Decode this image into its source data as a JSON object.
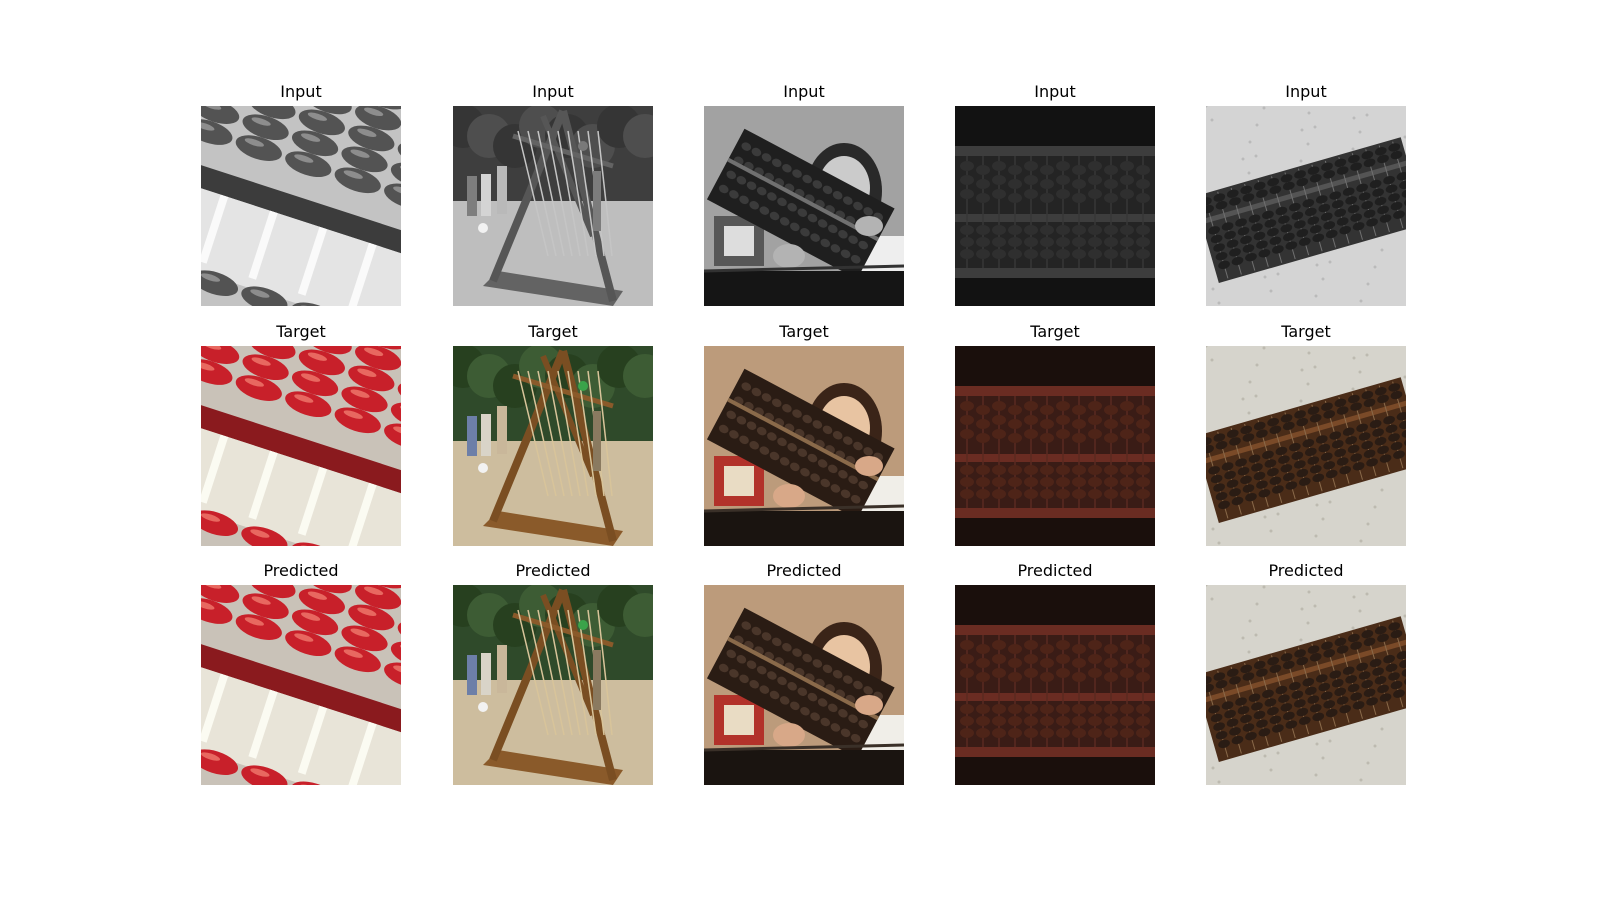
{
  "figure": {
    "rows": [
      {
        "row": "input",
        "items": [
          {
            "title": "Input",
            "image": "abacus-closeup-beads",
            "tone": "gray"
          },
          {
            "title": "Input",
            "image": "giant-wooden-abacus-park",
            "tone": "gray"
          },
          {
            "title": "Input",
            "image": "woman-holding-abacus",
            "tone": "gray"
          },
          {
            "title": "Input",
            "image": "abacus-dark-frame",
            "tone": "gray"
          },
          {
            "title": "Input",
            "image": "abacus-on-carpet",
            "tone": "gray"
          }
        ]
      },
      {
        "row": "target",
        "items": [
          {
            "title": "Target",
            "image": "abacus-closeup-beads",
            "tone": "color"
          },
          {
            "title": "Target",
            "image": "giant-wooden-abacus-park",
            "tone": "color"
          },
          {
            "title": "Target",
            "image": "woman-holding-abacus",
            "tone": "color"
          },
          {
            "title": "Target",
            "image": "abacus-dark-frame",
            "tone": "color"
          },
          {
            "title": "Target",
            "image": "abacus-on-carpet",
            "tone": "color"
          }
        ]
      },
      {
        "row": "predicted",
        "items": [
          {
            "title": "Predicted",
            "image": "abacus-closeup-beads",
            "tone": "color"
          },
          {
            "title": "Predicted",
            "image": "giant-wooden-abacus-park",
            "tone": "color"
          },
          {
            "title": "Predicted",
            "image": "woman-holding-abacus",
            "tone": "color"
          },
          {
            "title": "Predicted",
            "image": "abacus-dark-frame",
            "tone": "color"
          },
          {
            "title": "Predicted",
            "image": "abacus-on-carpet",
            "tone": "color"
          }
        ]
      }
    ]
  }
}
